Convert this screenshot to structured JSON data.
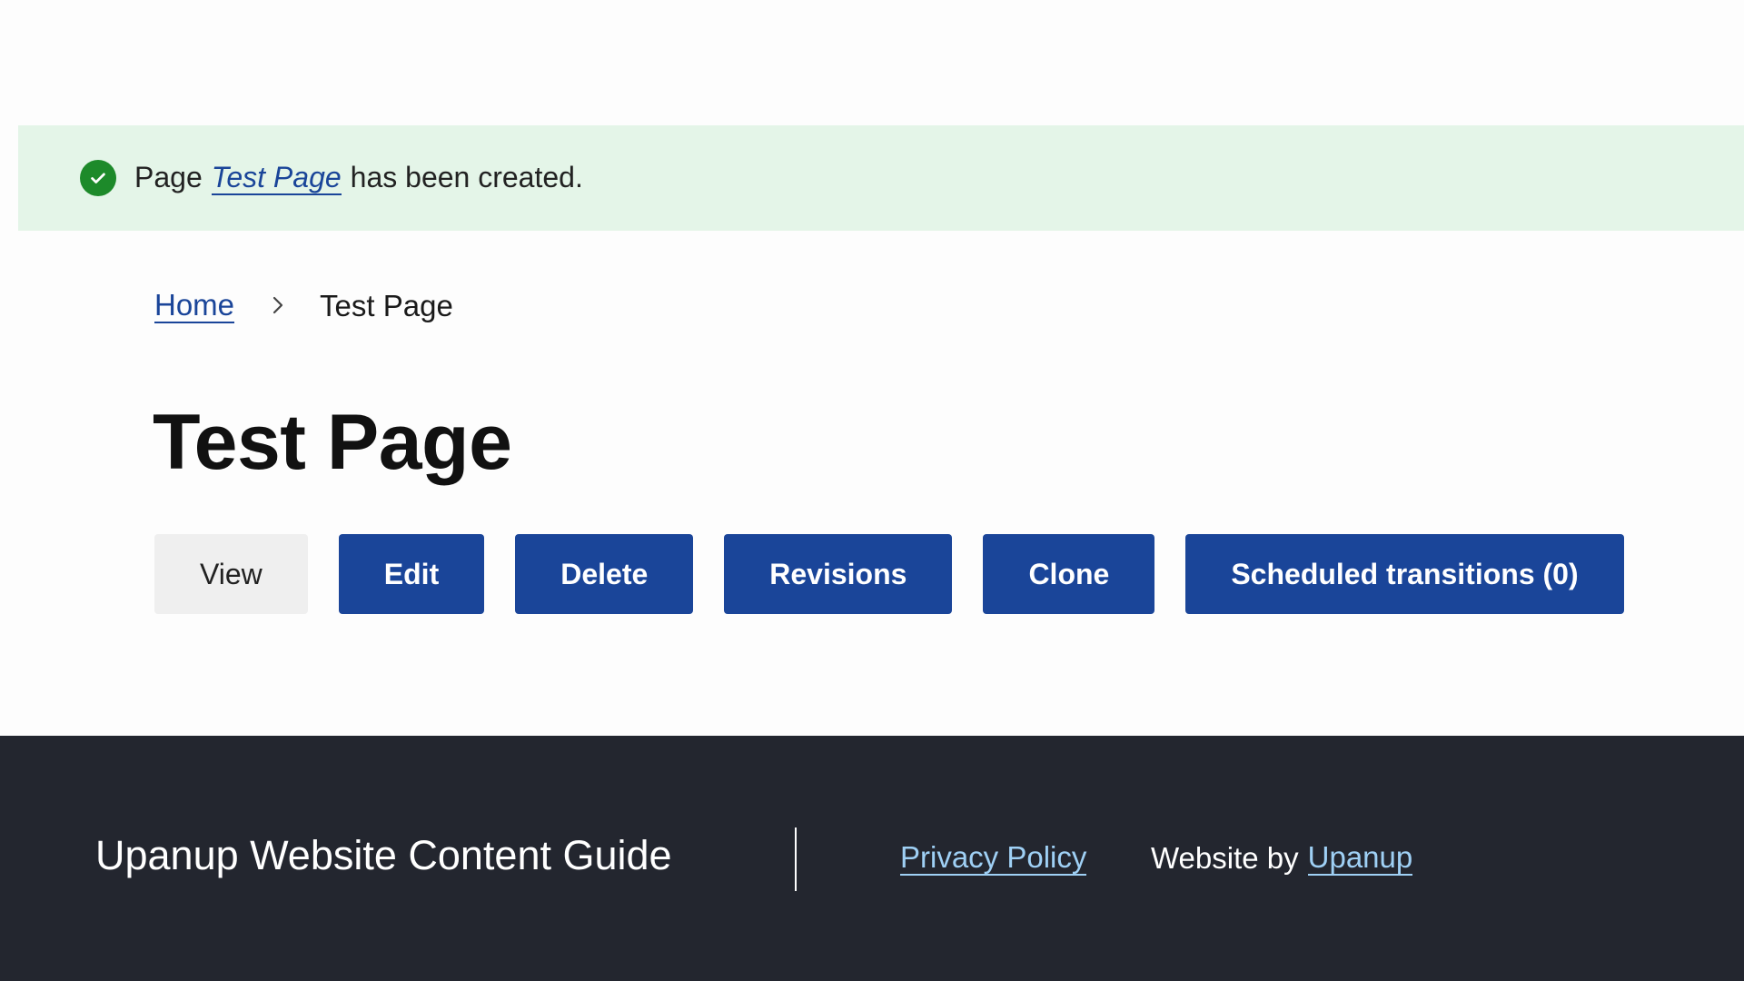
{
  "status": {
    "prefix": "Page",
    "link": "Test Page",
    "suffix": "has been created.",
    "icon": "check-circle-icon"
  },
  "breadcrumb": {
    "home": "Home",
    "current": "Test Page",
    "separator_icon": "chevron-right-icon"
  },
  "page": {
    "title": "Test Page"
  },
  "tabs": [
    {
      "label": "View",
      "active": true
    },
    {
      "label": "Edit",
      "active": false
    },
    {
      "label": "Delete",
      "active": false
    },
    {
      "label": "Revisions",
      "active": false
    },
    {
      "label": "Clone",
      "active": false
    },
    {
      "label": "Scheduled transitions (0)",
      "active": false
    }
  ],
  "footer": {
    "site_name": "Upanup Website Content Guide",
    "privacy_link": "Privacy Policy",
    "credit_prefix": "Website by",
    "credit_link": "Upanup"
  },
  "colors": {
    "primary": "#1a4599",
    "success_bg": "#e4f5e8",
    "success_icon": "#1d8a2a",
    "footer_bg": "#23262f",
    "footer_link": "#9fd0f5"
  }
}
